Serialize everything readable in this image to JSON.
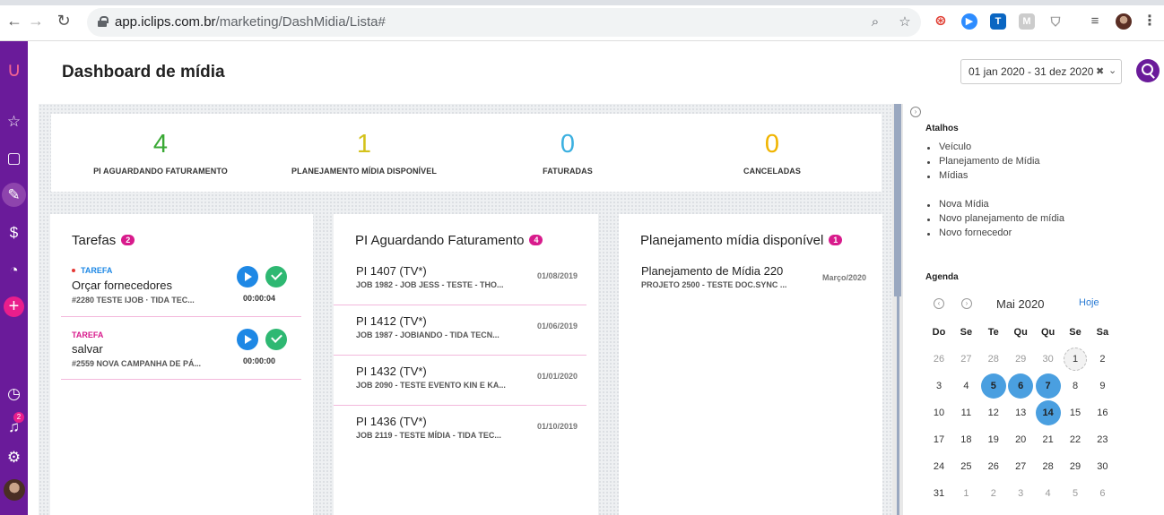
{
  "browser": {
    "url_host": "app.iclips.com.br",
    "url_path": "/marketing/DashMidia/Lista#"
  },
  "sidebar": {
    "notification_count": "2"
  },
  "header": {
    "title": "Dashboard de mídia",
    "date_range": "01 jan 2020 - 31 dez 2020"
  },
  "stats": [
    {
      "value": "4",
      "label": "PI AGUARDANDO FATURAMENTO",
      "color": "#3aa935"
    },
    {
      "value": "1",
      "label": "PLANEJAMENTO MÍDIA DISPONÍVEL",
      "color": "#d4c21c"
    },
    {
      "value": "0",
      "label": "FATURADAS",
      "color": "#3bb0e0"
    },
    {
      "value": "0",
      "label": "CANCELADAS",
      "color": "#f0b400"
    }
  ],
  "tasks_card": {
    "title": "Tarefas",
    "count": "2",
    "items": [
      {
        "type": "TAREFA",
        "name": "Orçar fornecedores",
        "meta": "#2280 TESTE IJOB  ·  TIDA TEC...",
        "timer": "00:00:04"
      },
      {
        "type": "TAREFA",
        "name": "salvar",
        "meta": "#2559 NOVA CAMPANHA DE PÁ...",
        "timer": "00:00:00"
      }
    ]
  },
  "pi_card": {
    "title": "PI Aguardando Faturamento",
    "count": "4",
    "items": [
      {
        "title": "PI 1407 (TV*)",
        "meta": "JOB 1982 - JOB JESS - TESTE - THO...",
        "date": "01/08/2019"
      },
      {
        "title": "PI 1412 (TV*)",
        "meta": "JOB 1987 - JOBIANDO - TIDA TECN...",
        "date": "01/06/2019"
      },
      {
        "title": "PI 1432 (TV*)",
        "meta": "JOB 2090 - TESTE EVENTO KIN E KA...",
        "date": "01/01/2020"
      },
      {
        "title": "PI 1436 (TV*)",
        "meta": "JOB 2119 - TESTE MÍDIA - TIDA TEC...",
        "date": "01/10/2019"
      }
    ]
  },
  "plan_card": {
    "title": "Planejamento mídia disponível",
    "count": "1",
    "items": [
      {
        "title": "Planejamento de Mídia 220",
        "meta": "PROJETO 2500 - TESTE DOC.SYNC ...",
        "date": "Março/2020"
      }
    ]
  },
  "right_panel": {
    "shortcuts_title": "Atalhos",
    "shortcuts_group1": [
      "Veículo",
      "Planejamento de Mídia",
      "Mídias"
    ],
    "shortcuts_group2": [
      "Nova Mídia",
      "Novo planejamento de mídia",
      "Novo fornecedor"
    ],
    "agenda_title": "Agenda",
    "month": "Mai 2020",
    "today_label": "Hoje",
    "weekdays": [
      "Do",
      "Se",
      "Te",
      "Qu",
      "Qu",
      "Se",
      "Sa"
    ],
    "weeks": [
      [
        "26",
        "27",
        "28",
        "29",
        "30",
        "1",
        "2"
      ],
      [
        "3",
        "4",
        "5",
        "6",
        "7",
        "8",
        "9"
      ],
      [
        "10",
        "11",
        "12",
        "13",
        "14",
        "15",
        "16"
      ],
      [
        "17",
        "18",
        "19",
        "20",
        "21",
        "22",
        "23"
      ],
      [
        "24",
        "25",
        "26",
        "27",
        "28",
        "29",
        "30"
      ],
      [
        "31",
        "1",
        "2",
        "3",
        "4",
        "5",
        "6"
      ]
    ],
    "highlighted_days": [
      "5",
      "6",
      "7",
      "14"
    ]
  }
}
